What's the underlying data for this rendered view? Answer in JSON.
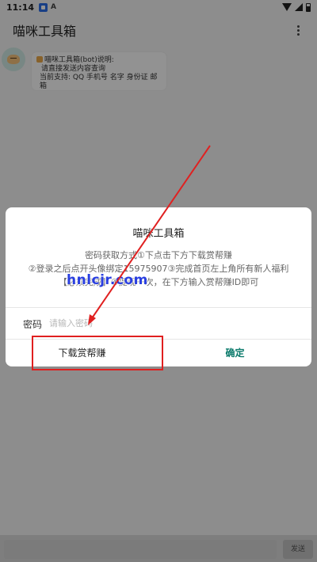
{
  "status_bar": {
    "time": "11:14",
    "a_icon": "A"
  },
  "app_bar": {
    "title": "喵咪工具箱"
  },
  "chat": {
    "bubble_lines": [
      "喵咪工具箱(bot)说明:",
      "请直接发送内容查询",
      "当前支持: QQ 手机号 名字 身份证 邮箱"
    ]
  },
  "dialog": {
    "title": "喵咪工具箱",
    "message_lines": [
      "密码获取方式①下点击下方下载赏帮赚",
      "②登录之后点开头像绑定15975907③完成首页左上角所有新人福利",
      "【必须完成】④提现一次，在下方输入赏帮赚ID即可"
    ],
    "password_label": "密码",
    "password_placeholder": "请输入密码",
    "password_value": "",
    "download_button": "下载赏帮赚",
    "confirm_button": "确定"
  },
  "input_bar": {
    "send_label": "发送"
  },
  "annotations": {
    "watermark": "hnlcjr.com",
    "highlight_color": "#e02020"
  },
  "colors": {
    "accent": "#0b7a6b",
    "watermark": "#2a3fe0"
  }
}
